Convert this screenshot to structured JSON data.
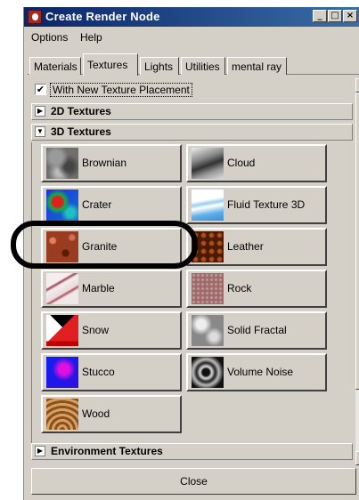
{
  "window": {
    "title": "Create Render Node",
    "min_glyph": "_",
    "max_glyph": "□",
    "close_glyph": "×"
  },
  "menu": [
    "Options",
    "Help"
  ],
  "tabs": [
    {
      "label": "Materials",
      "active": false
    },
    {
      "label": "Textures",
      "active": true
    },
    {
      "label": "Lights",
      "active": false
    },
    {
      "label": "Utilities",
      "active": false
    },
    {
      "label": "mental ray",
      "active": false
    }
  ],
  "placement_option": {
    "label": "With New Texture Placement",
    "checked": true,
    "mark": "✔"
  },
  "sections": [
    {
      "label": "2D Textures",
      "expanded": false,
      "arrow": "▶"
    },
    {
      "label": "3D Textures",
      "expanded": true,
      "arrow": "▼"
    },
    {
      "label": "Environment Textures",
      "expanded": false,
      "arrow": "▶"
    }
  ],
  "textures": [
    {
      "label": "Brownian",
      "icon": "brownian-swatch"
    },
    {
      "label": "Cloud",
      "icon": "cloud-swatch"
    },
    {
      "label": "Crater",
      "icon": "crater-swatch"
    },
    {
      "label": "Fluid Texture 3D",
      "icon": "fluid-texture-swatch"
    },
    {
      "label": "Granite",
      "icon": "granite-swatch",
      "highlighted": true
    },
    {
      "label": "Leather",
      "icon": "leather-swatch"
    },
    {
      "label": "Marble",
      "icon": "marble-swatch"
    },
    {
      "label": "Rock",
      "icon": "rock-swatch"
    },
    {
      "label": "Snow",
      "icon": "snow-swatch"
    },
    {
      "label": "Solid Fractal",
      "icon": "solid-fractal-swatch"
    },
    {
      "label": "Stucco",
      "icon": "stucco-swatch"
    },
    {
      "label": "Volume Noise",
      "icon": "volume-noise-swatch"
    },
    {
      "label": "Wood",
      "icon": "wood-swatch"
    }
  ],
  "scrollbar": {
    "up_glyph": "▲",
    "down_glyph": "▼"
  },
  "close_button": "Close",
  "colors": {
    "titlebar_start": "#0a246a",
    "titlebar_end": "#3a6ea5",
    "face": "#d4d0c8"
  }
}
